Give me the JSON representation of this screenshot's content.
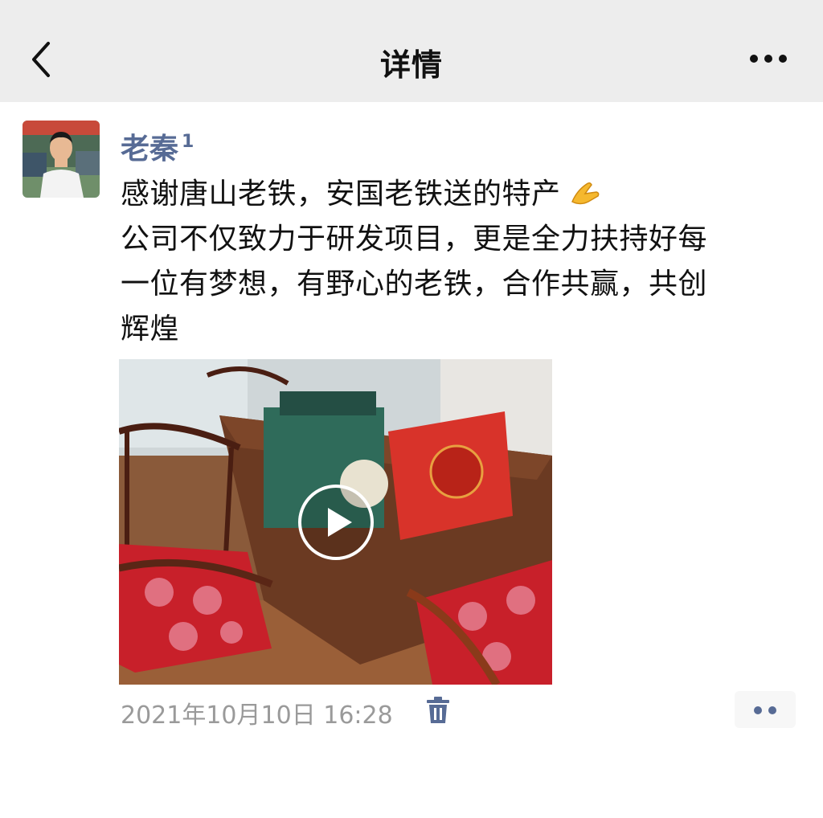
{
  "nav": {
    "title": "详情",
    "back_icon": "back-arrow-icon",
    "more_icon": "more-dots-icon"
  },
  "post": {
    "author": "老秦",
    "author_badge": "1",
    "lines": [
      "感谢唐山老铁，安国老铁送的特产",
      "公司不仅致力于研发项目，更是全力扶持好每",
      "一位有梦想，有野心的老铁，合作共赢，共创",
      "辉煌"
    ],
    "emoji_icon": "pinched-fingers-emoji",
    "timestamp": "2021年10月10日 16:28",
    "delete_icon": "trash-icon",
    "action_icon": "two-dots-icon"
  },
  "colors": {
    "nav_bg": "#ededed",
    "link_blue": "#576b95",
    "timestamp_gray": "#9a9a9a"
  }
}
